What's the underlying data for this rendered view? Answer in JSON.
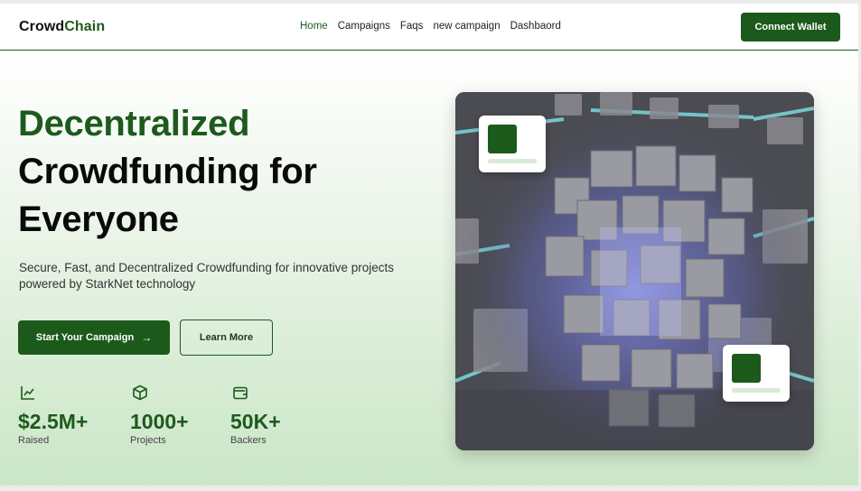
{
  "logo": {
    "part1": "Crowd",
    "part2": "Chain"
  },
  "nav": [
    "Home",
    "Campaigns",
    "Faqs",
    "new campaign",
    "Dashbaord"
  ],
  "header": {
    "connect_label": "Connect Wallet"
  },
  "hero": {
    "line1": "Decentralized",
    "line2": "Crowdfunding for",
    "line3": "Everyone",
    "subtitle": "Secure, Fast, and Decentralized Crowdfunding for innovative projects powered by StarkNet technology",
    "start_label": "Start Your Campaign",
    "start_arrow": "→",
    "learn_label": "Learn More"
  },
  "stats": [
    {
      "icon": "chart-line-icon",
      "value": "$2.5M+",
      "label": "Raised"
    },
    {
      "icon": "box-icon",
      "value": "1000+",
      "label": "Projects"
    },
    {
      "icon": "wallet-icon",
      "value": "50K+",
      "label": "Backers"
    }
  ],
  "colors": {
    "brand": "#1c5a1c",
    "accent_glow": "#6f78e8",
    "hero_bottom": "#cbe6c7"
  }
}
